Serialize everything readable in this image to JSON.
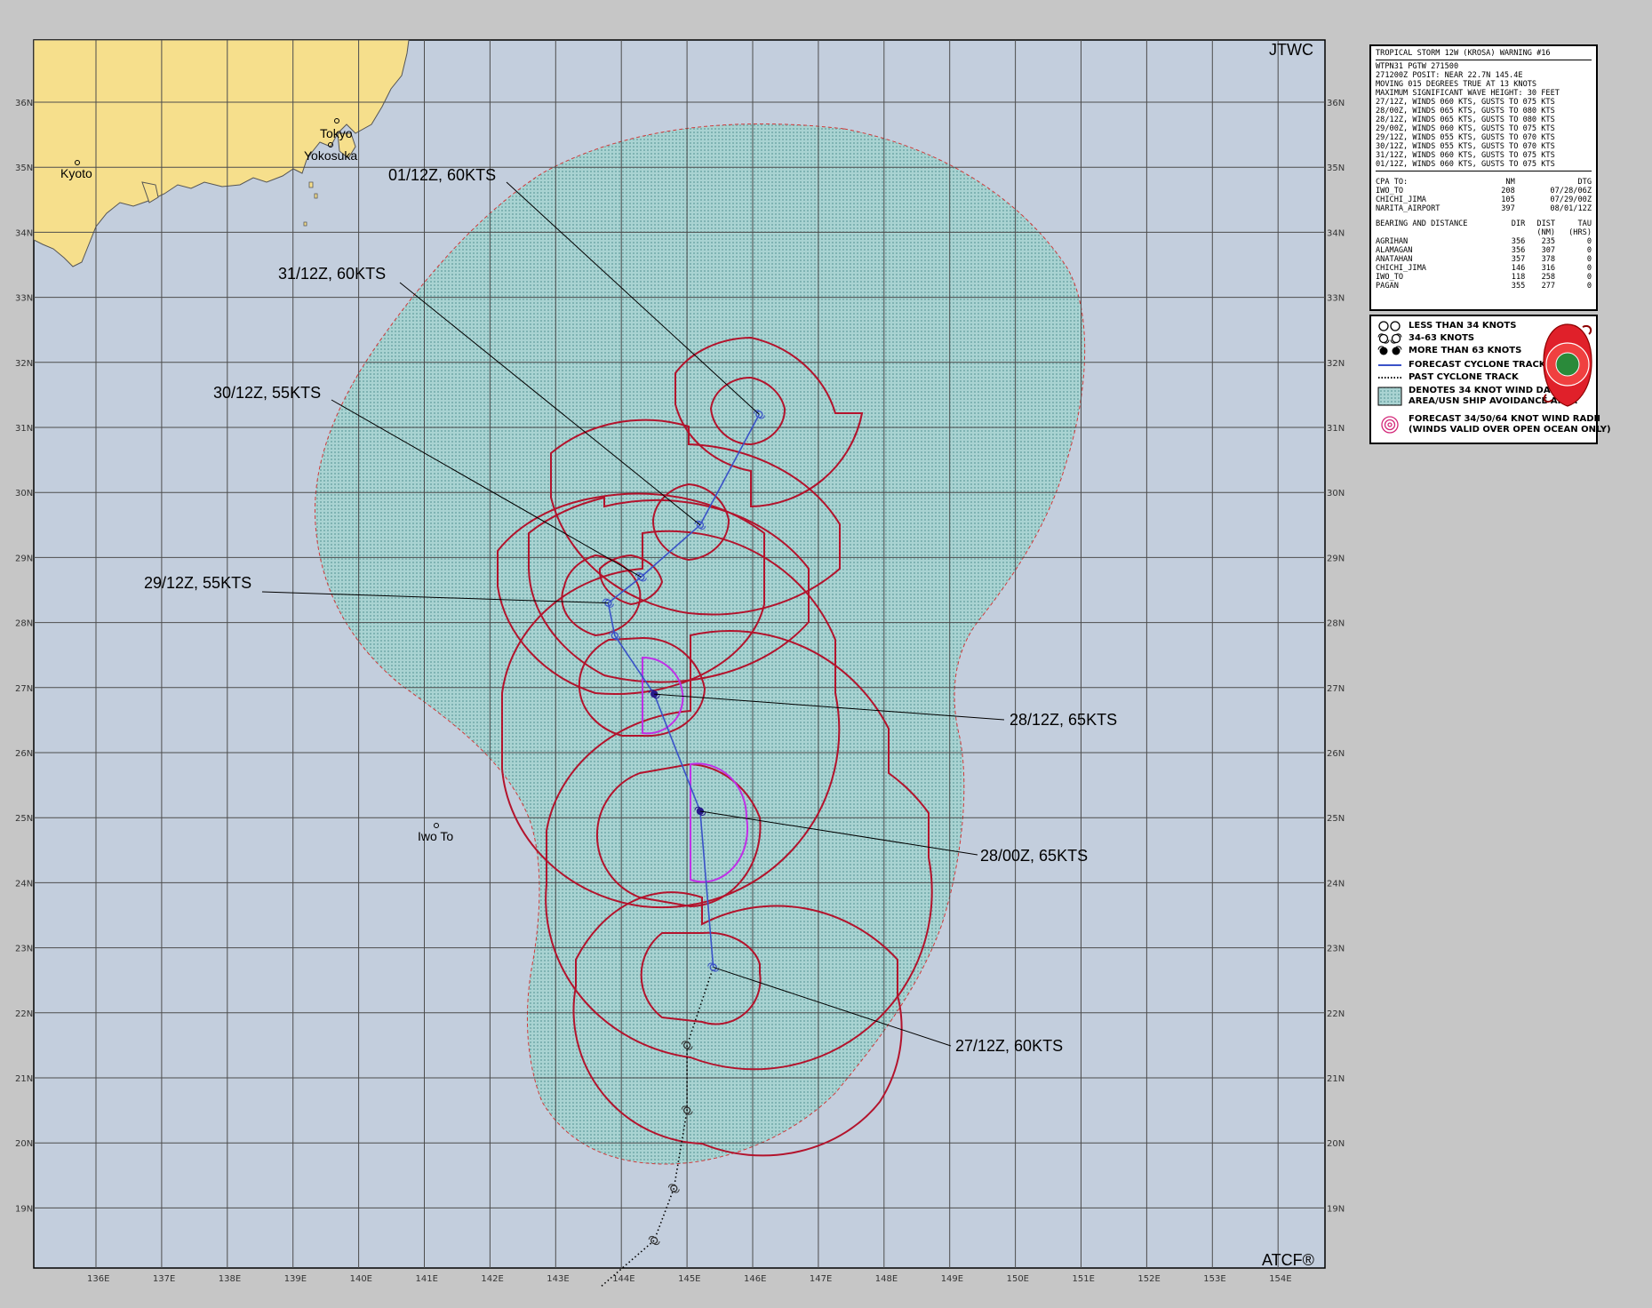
{
  "map": {
    "agency_label": "JTWC",
    "software_label": "ATCF®",
    "longitude_ticks": [
      "136E",
      "137E",
      "138E",
      "139E",
      "140E",
      "141E",
      "142E",
      "143E",
      "144E",
      "145E",
      "146E",
      "147E",
      "148E",
      "149E",
      "150E",
      "151E",
      "152E",
      "153E",
      "154E"
    ],
    "latitude_ticks": [
      "36N",
      "35N",
      "34N",
      "33N",
      "32N",
      "31N",
      "30N",
      "29N",
      "28N",
      "27N",
      "26N",
      "25N",
      "24N",
      "23N",
      "22N",
      "21N",
      "20N",
      "19N"
    ],
    "cities": [
      {
        "name": "Kyoto"
      },
      {
        "name": "Tokyo"
      },
      {
        "name": "Yokosuka"
      },
      {
        "name": "Iwo To"
      }
    ],
    "forecast_labels": [
      {
        "label": "27/12Z,  60KTS",
        "time": "27/12Z",
        "intensity_kts": 60,
        "lat": 22.7,
        "lon": 145.4
      },
      {
        "label": "28/00Z,  65KTS",
        "time": "28/00Z",
        "intensity_kts": 65,
        "lat": 25.1,
        "lon": 145.2
      },
      {
        "label": "28/12Z,  65KTS",
        "time": "28/12Z",
        "intensity_kts": 65,
        "lat": 26.9,
        "lon": 144.5
      },
      {
        "label": "29/12Z,  55KTS",
        "time": "29/12Z",
        "intensity_kts": 55,
        "lat": 28.3,
        "lon": 143.8
      },
      {
        "label": "30/12Z,  55KTS",
        "time": "30/12Z",
        "intensity_kts": 55,
        "lat": 28.7,
        "lon": 144.3
      },
      {
        "label": "31/12Z,  60KTS",
        "time": "31/12Z",
        "intensity_kts": 60,
        "lat": 29.5,
        "lon": 145.2
      },
      {
        "label": "01/12Z,  60KTS",
        "time": "01/12Z",
        "intensity_kts": 60,
        "lat": 31.2,
        "lon": 146.1
      }
    ],
    "past_track": [
      {
        "lat": 17.8,
        "lon": 143.7
      },
      {
        "lat": 18.5,
        "lon": 144.5
      },
      {
        "lat": 19.3,
        "lon": 144.8
      },
      {
        "lat": 20.5,
        "lon": 145.0
      },
      {
        "lat": 21.5,
        "lon": 145.0
      },
      {
        "lat": 22.7,
        "lon": 145.4
      }
    ],
    "forecast_track": [
      {
        "lat": 22.7,
        "lon": 145.4
      },
      {
        "lat": 25.1,
        "lon": 145.2
      },
      {
        "lat": 26.9,
        "lon": 144.5
      },
      {
        "lat": 27.8,
        "lon": 143.9
      },
      {
        "lat": 28.3,
        "lon": 143.8
      },
      {
        "lat": 28.7,
        "lon": 144.3
      },
      {
        "lat": 29.5,
        "lon": 145.2
      },
      {
        "lat": 31.2,
        "lon": 146.1
      }
    ],
    "colors": {
      "ocean": "#c3cedd",
      "land": "#f6df8c",
      "grid": "#4d4d4d",
      "danger_area": "#9ed1cf",
      "wind_radii": "#b3132c",
      "track": "#3a52c8",
      "radii_64kt": "#c030e6"
    }
  },
  "warning": {
    "title": "TROPICAL STORM 12W (KROSA) WARNING #16",
    "header_lines": [
      "WTPN31 PGTW 271500",
      "271200Z POSIT: NEAR 22.7N 145.4E",
      "MOVING 015 DEGREES TRUE AT 13 KNOTS",
      "MAXIMUM SIGNIFICANT WAVE HEIGHT: 30 FEET"
    ],
    "forecast_lines": [
      "27/12Z, WINDS 060 KTS, GUSTS TO 075 KTS",
      "28/00Z, WINDS 065 KTS, GUSTS TO 080 KTS",
      "28/12Z, WINDS 065 KTS, GUSTS TO 080 KTS",
      "29/00Z, WINDS 060 KTS, GUSTS TO 075 KTS",
      "29/12Z, WINDS 055 KTS, GUSTS TO 070 KTS",
      "30/12Z, WINDS 055 KTS, GUSTS TO 070 KTS",
      "31/12Z, WINDS 060 KTS, GUSTS TO 075 KTS",
      "01/12Z, WINDS 060 KTS, GUSTS TO 075 KTS"
    ],
    "cpa_header": [
      "CPA TO:",
      "NM",
      "DTG"
    ],
    "cpa_rows": [
      [
        "IWO_TO",
        "208",
        "07/28/06Z"
      ],
      [
        "CHICHI_JIMA",
        "105",
        "07/29/00Z"
      ],
      [
        "NARITA_AIRPORT",
        "397",
        "08/01/12Z"
      ]
    ],
    "bearing_header": [
      "BEARING AND DISTANCE",
      "DIR",
      "DIST",
      "TAU"
    ],
    "bearing_units": [
      "",
      "",
      "(NM)",
      "(HRS)"
    ],
    "bearing_rows": [
      [
        "AGRIHAN",
        "356",
        "235",
        "0"
      ],
      [
        "ALAMAGAN",
        "356",
        "307",
        "0"
      ],
      [
        "ANATAHAN",
        "357",
        "378",
        "0"
      ],
      [
        "CHICHI_JIMA",
        "146",
        "316",
        "0"
      ],
      [
        "IWO_TO",
        "118",
        "258",
        "0"
      ],
      [
        "PAGAN",
        "355",
        "277",
        "0"
      ]
    ]
  },
  "legend": {
    "items": [
      {
        "icon": "less-than-34kt-icon",
        "label": "LESS THAN 34 KNOTS"
      },
      {
        "icon": "34-63kt-icon",
        "label": "34-63 KNOTS"
      },
      {
        "icon": "more-than-63kt-icon",
        "label": "MORE THAN 63 KNOTS"
      },
      {
        "icon": "forecast-track-icon",
        "label": "FORECAST CYCLONE TRACK"
      },
      {
        "icon": "past-track-icon",
        "label": "PAST CYCLONE TRACK"
      },
      {
        "icon": "danger-area-icon",
        "label": "DENOTES 34 KNOT WIND DANGER\nAREA/USN SHIP AVOIDANCE AREA"
      },
      {
        "icon": "wind-radii-icon",
        "label": "FORECAST 34/50/64 KNOT WIND RADII\n(WINDS VALID OVER OPEN OCEAN ONLY)"
      }
    ]
  }
}
